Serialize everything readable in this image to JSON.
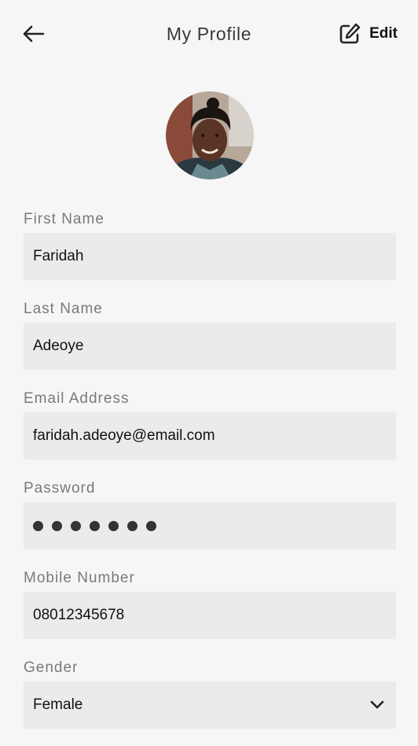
{
  "header": {
    "title": "My Profile",
    "edit_label": "Edit"
  },
  "icons": {
    "back": "arrow-left-icon",
    "edit": "edit-square-icon",
    "chevron": "chevron-down-icon"
  },
  "form": {
    "first_name": {
      "label": "First Name",
      "value": "Faridah"
    },
    "last_name": {
      "label": "Last Name",
      "value": "Adeoye"
    },
    "email": {
      "label": "Email Address",
      "value": "faridah.adeoye@email.com"
    },
    "password": {
      "label": "Password",
      "masked_length": 7
    },
    "mobile": {
      "label": "Mobile Number",
      "value": "08012345678"
    },
    "gender": {
      "label": "Gender",
      "value": "Female"
    }
  },
  "colors": {
    "background": "#f6f6f6",
    "field_background": "#ebebeb",
    "label": "#7a7a7a",
    "text": "#111111"
  }
}
